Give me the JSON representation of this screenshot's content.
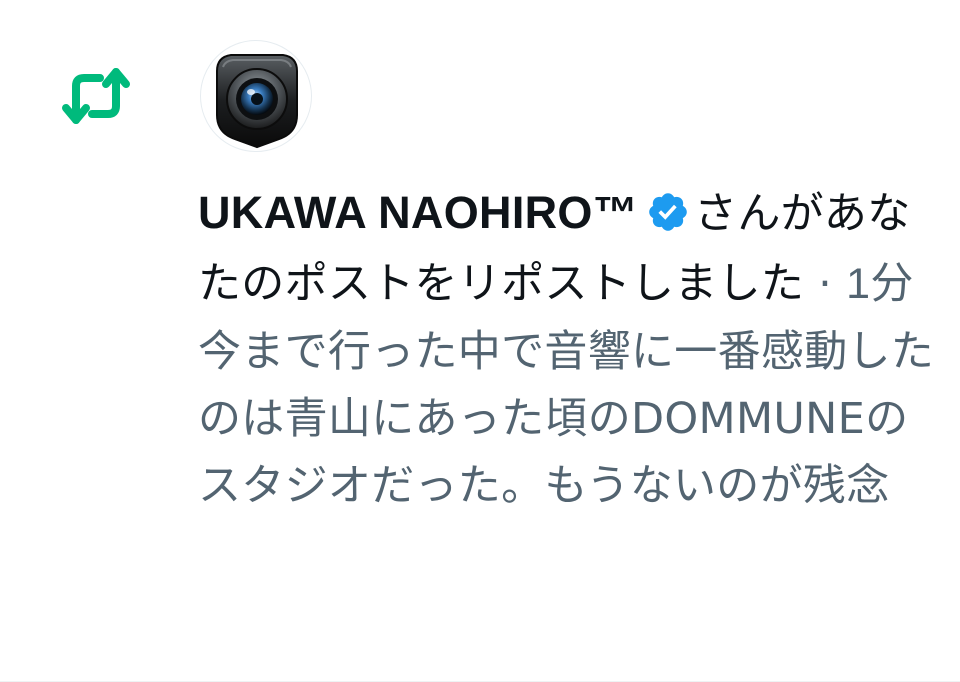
{
  "notification": {
    "type_icon": "repost-icon",
    "avatar_icon": "camera-lens-icon",
    "user_name": "UKAWA NAOHIRO™",
    "verified": true,
    "verified_icon": "verified-badge-icon",
    "action_text": "さんがあなたのポストをリポストしました",
    "separator": " · ",
    "time_ago": "1分",
    "post_preview": "今まで行った中で音響に一番感動したのは青山にあった頃のDOMMUNEのスタジオだった。もうないのが残念"
  },
  "colors": {
    "repost_green": "#00ba7c",
    "verified_blue": "#1d9bf0",
    "text_primary": "#0f1419",
    "text_secondary": "#536471"
  }
}
